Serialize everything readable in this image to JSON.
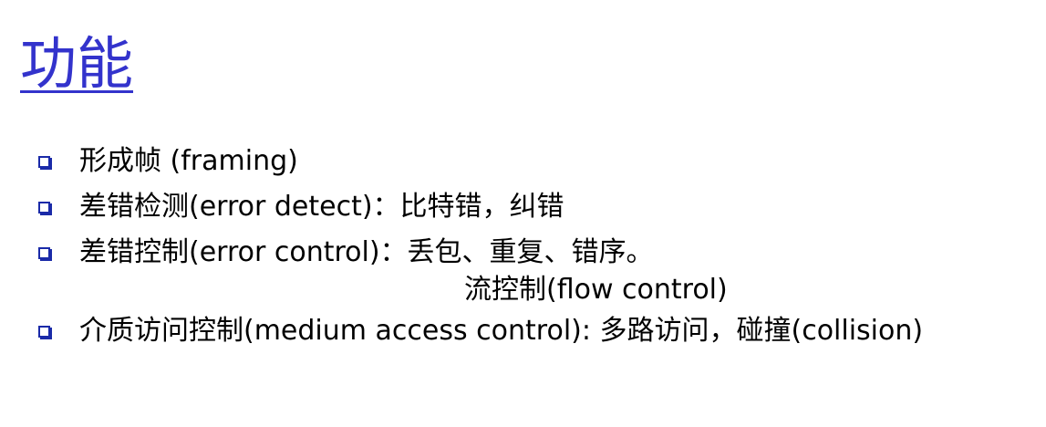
{
  "slide": {
    "title": "功能",
    "bullets": [
      {
        "text": "形成帧 (framing)"
      },
      {
        "text": "差错检测(error detect)：比特错，纠错"
      },
      {
        "text": "差错控制(error control)：丢包、重复、错序。",
        "continuation": "流控制(flow control)"
      },
      {
        "text": "介质访问控制(medium access control): 多路访问，碰撞(collision)"
      }
    ]
  },
  "colors": {
    "title": "#3333cc",
    "bullet_marker": "#1a2aa8",
    "text": "#000000"
  },
  "icons": {
    "bullet_marker": "square-bullet-icon"
  }
}
